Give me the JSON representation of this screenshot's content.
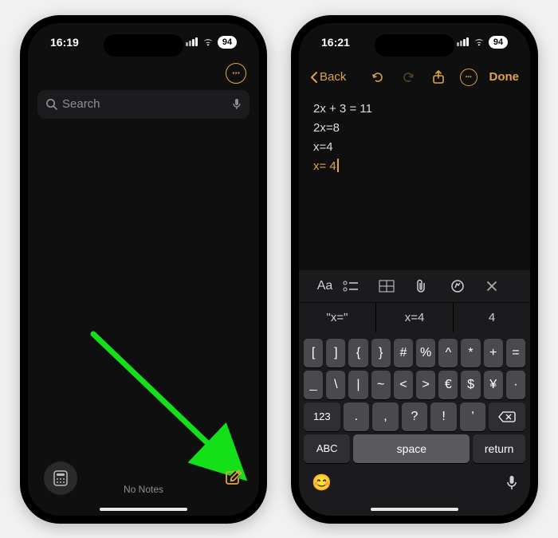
{
  "accent": "#e0a24a",
  "arrow_color": "#14e01a",
  "phone1": {
    "status": {
      "time": "16:19",
      "battery": "94"
    },
    "search_placeholder": "Search",
    "no_notes": "No Notes"
  },
  "phone2": {
    "status": {
      "time": "16:21",
      "battery": "94"
    },
    "nav": {
      "back": "Back",
      "done": "Done"
    },
    "lines": [
      "2x + 3 = 11",
      "2x=8",
      "x=4"
    ],
    "typing": "x= 4",
    "toolbar": {
      "aa": "Aa"
    },
    "predictions": [
      "\"x=\"",
      "x=4",
      "4"
    ],
    "keys": {
      "row1": [
        "[",
        "]",
        "{",
        "}",
        "#",
        "%",
        "^",
        "*",
        "+",
        "="
      ],
      "row2": [
        "_",
        "\\",
        "|",
        "~",
        "<",
        ">",
        "€",
        "$",
        "¥",
        "·"
      ],
      "label123": "123",
      "row3": [
        ".",
        ",",
        "?",
        "!",
        "'"
      ],
      "labelABC": "ABC",
      "space": "space",
      "return": "return"
    }
  }
}
